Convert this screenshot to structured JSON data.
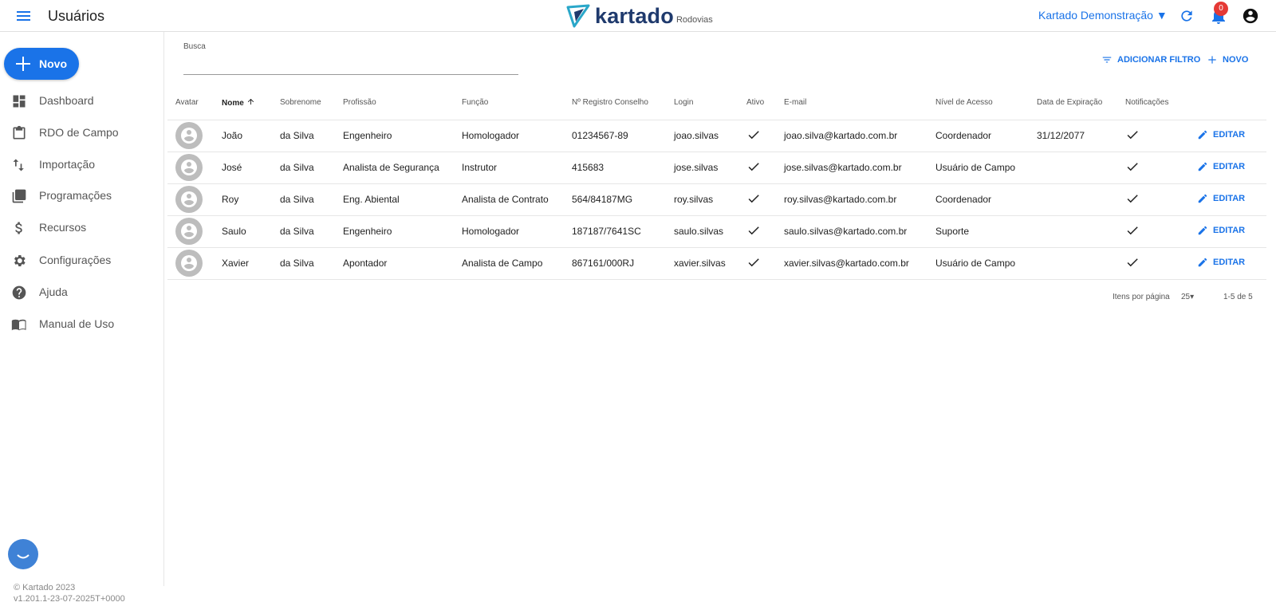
{
  "header": {
    "title": "Usuários",
    "logo_text": "kartado",
    "logo_sub": "Rodovias",
    "org_label": "Kartado Demonstração ▼",
    "notifications_count": "0"
  },
  "sidebar": {
    "new_label": "Novo",
    "items": [
      {
        "label": "Dashboard",
        "icon": "dashboard-icon"
      },
      {
        "label": "RDO de Campo",
        "icon": "clipboard-icon"
      },
      {
        "label": "Importação",
        "icon": "import-icon"
      },
      {
        "label": "Programações",
        "icon": "library-icon"
      },
      {
        "label": "Recursos",
        "icon": "dollar-icon"
      },
      {
        "label": "Configurações",
        "icon": "gear-icon"
      },
      {
        "label": "Ajuda",
        "icon": "help-icon"
      },
      {
        "label": "Manual de Uso",
        "icon": "book-icon"
      }
    ],
    "footer_copyright": "© Kartado 2023",
    "footer_version": "v1.201.1-23-07-2025T+0000"
  },
  "search": {
    "label": "Busca",
    "value": ""
  },
  "actions": {
    "add_filter": "ADICIONAR FILTRO",
    "new": "NOVO"
  },
  "table": {
    "columns": [
      "Avatar",
      "Nome",
      "Sobrenome",
      "Profissão",
      "Função",
      "Nº Registro Conselho",
      "Login",
      "Ativo",
      "E-mail",
      "Nível de Acesso",
      "Data de Expiração",
      "Notificações",
      ""
    ],
    "edit_label": "EDITAR",
    "rows": [
      {
        "nome": "João",
        "sobrenome": "da Silva",
        "profissao": "Engenheiro",
        "funcao": "Homologador",
        "registro": "01234567-89",
        "login": "joao.silvas",
        "ativo": true,
        "email": "joao.silva@kartado.com.br",
        "nivel": "Coordenador",
        "expiracao": "31/12/2077",
        "notificacoes": true
      },
      {
        "nome": "José",
        "sobrenome": "da Silva",
        "profissao": "Analista de Segurança",
        "funcao": "Instrutor",
        "registro": "415683",
        "login": "jose.silvas",
        "ativo": true,
        "email": "jose.silvas@kartado.com.br",
        "nivel": "Usuário de Campo",
        "expiracao": "",
        "notificacoes": true
      },
      {
        "nome": "Roy",
        "sobrenome": "da Silva",
        "profissao": "Eng. Abiental",
        "funcao": "Analista de Contrato",
        "registro": "564/84187MG",
        "login": "roy.silvas",
        "ativo": true,
        "email": "roy.silvas@kartado.com.br",
        "nivel": "Coordenador",
        "expiracao": "",
        "notificacoes": true
      },
      {
        "nome": "Saulo",
        "sobrenome": "da Silva",
        "profissao": "Engenheiro",
        "funcao": "Homologador",
        "registro": "187187/7641SC",
        "login": "saulo.silvas",
        "ativo": true,
        "email": "saulo.silvas@kartado.com.br",
        "nivel": "Suporte",
        "expiracao": "",
        "notificacoes": true
      },
      {
        "nome": "Xavier",
        "sobrenome": "da Silva",
        "profissao": "Apontador",
        "funcao": "Analista de Campo",
        "registro": "867161/000RJ",
        "login": "xavier.silvas",
        "ativo": true,
        "email": "xavier.silvas@kartado.com.br",
        "nivel": "Usuário de Campo",
        "expiracao": "",
        "notificacoes": true
      }
    ]
  },
  "pagination": {
    "items_per_page_label": "Itens por página",
    "items_per_page": "25",
    "range": "1-5 de 5"
  },
  "colors": {
    "accent": "#1a73e8",
    "badge": "#e53935",
    "logo": "#1f3a6d"
  }
}
